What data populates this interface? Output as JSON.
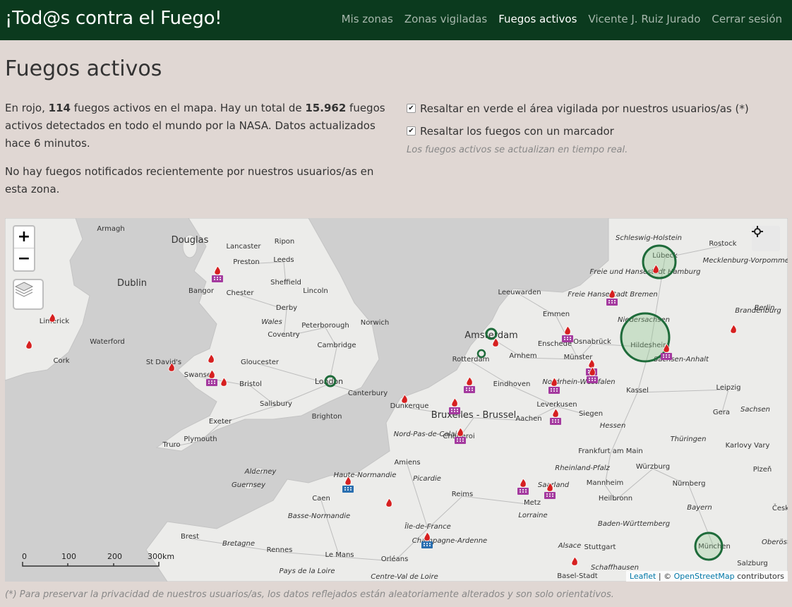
{
  "navbar": {
    "brand": "¡Tod@s contra el Fuego!",
    "links": [
      "Mis zonas",
      "Zonas vigiladas",
      "Fuegos activos",
      "Vicente J. Ruiz Jurado",
      "Cerrar sesión"
    ],
    "active_index": 2
  },
  "page": {
    "title": "Fuegos activos",
    "intro": {
      "p1": "En rojo, ",
      "count_visible": "114",
      "p2": " fuegos activos en el mapa. Hay un total de ",
      "count_total": "15.962",
      "p3": " fuegos activos detectados en todo el mundo por la NASA. Datos actualizados hace 6 minutos."
    },
    "notice": "No hay fuegos notificados recientemente por nuestros usuarios/as en esta zona.",
    "options": {
      "highlight_area": {
        "label": "Resaltar en verde el área vigilada por nuestros usuarios/as (*)",
        "checked": true
      },
      "highlight_markers": {
        "label": "Resaltar los fuegos con un marcador",
        "checked": true
      }
    },
    "realtime_note": "Los fuegos activos se actualizan en tiempo real.",
    "footer_note": "(*) Para preservar la privacidad de nuestros usuarios/as, los datos reflejados están aleatoriamente alterados y son solo orientativos."
  },
  "map": {
    "zoom_in": "+",
    "zoom_out": "−",
    "scale_labels": [
      "0",
      "100",
      "200",
      "300km"
    ],
    "attribution": {
      "leaflet": "Leaflet",
      "sep": " | © ",
      "osm": "OpenStreetMap",
      "suffix": " contributors"
    },
    "cities": [
      {
        "name": "Armagh"
      },
      {
        "name": "Douglas"
      },
      {
        "name": "Lancaster"
      },
      {
        "name": "Ripon"
      },
      {
        "name": "Preston"
      },
      {
        "name": "Leeds"
      },
      {
        "name": "Dublin"
      },
      {
        "name": "Bangor"
      },
      {
        "name": "Sheffield"
      },
      {
        "name": "Chester"
      },
      {
        "name": "Lincoln"
      },
      {
        "name": "Derby"
      },
      {
        "name": "Limerick"
      },
      {
        "name": "Wales"
      },
      {
        "name": "Norwich"
      },
      {
        "name": "Coventry"
      },
      {
        "name": "Peterborough"
      },
      {
        "name": "Waterford"
      },
      {
        "name": "Cambridge"
      },
      {
        "name": "Cork"
      },
      {
        "name": "St David's"
      },
      {
        "name": "Gloucester"
      },
      {
        "name": "Swansea"
      },
      {
        "name": "Bristol"
      },
      {
        "name": "London"
      },
      {
        "name": "Canterbury"
      },
      {
        "name": "Salisbury"
      },
      {
        "name": "Dunkerque"
      },
      {
        "name": "Exeter"
      },
      {
        "name": "Brighton"
      },
      {
        "name": "Truro"
      },
      {
        "name": "Plymouth"
      },
      {
        "name": "Leeuwarden"
      },
      {
        "name": "Emmen"
      },
      {
        "name": "Amsterdam"
      },
      {
        "name": "Enschede"
      },
      {
        "name": "Osnabrück"
      },
      {
        "name": "Rotterdam"
      },
      {
        "name": "Arnhem"
      },
      {
        "name": "Münster"
      },
      {
        "name": "Eindhoven"
      },
      {
        "name": "Bruxelles - Brussel"
      },
      {
        "name": "Leverkusen"
      },
      {
        "name": "Aachen"
      },
      {
        "name": "Siegen"
      },
      {
        "name": "Charleroi"
      },
      {
        "name": "Nord-Pas-de-Calais"
      },
      {
        "name": "Amiens"
      },
      {
        "name": "Picardie"
      },
      {
        "name": "Reims"
      },
      {
        "name": "Alderney"
      },
      {
        "name": "Guernsey"
      },
      {
        "name": "Caen"
      },
      {
        "name": "Haute-Normandie"
      },
      {
        "name": "Basse-Normandie"
      },
      {
        "name": "Île-de-France"
      },
      {
        "name": "Champagne-Ardenne"
      },
      {
        "name": "Metz"
      },
      {
        "name": "Lorraine"
      },
      {
        "name": "Alsace"
      },
      {
        "name": "Brest"
      },
      {
        "name": "Bretagne"
      },
      {
        "name": "Rennes"
      },
      {
        "name": "Le Mans"
      },
      {
        "name": "Orléans"
      },
      {
        "name": "Pays de la Loire"
      },
      {
        "name": "Centre-Val de Loire"
      },
      {
        "name": "Schleswig-Holstein"
      },
      {
        "name": "Rostock"
      },
      {
        "name": "Lübeck"
      },
      {
        "name": "Mecklenburg-Vorpommern"
      },
      {
        "name": "Freie und Hansestadt Hamburg"
      },
      {
        "name": "Freie Hansestadt Bremen"
      },
      {
        "name": "Brandenburg"
      },
      {
        "name": "Berlin"
      },
      {
        "name": "Niedersachsen"
      },
      {
        "name": "Hildesheim"
      },
      {
        "name": "Sachsen-Anhalt"
      },
      {
        "name": "Nordrhein-Westfalen"
      },
      {
        "name": "Kassel"
      },
      {
        "name": "Leipzig"
      },
      {
        "name": "Gera"
      },
      {
        "name": "Sachsen"
      },
      {
        "name": "Hessen"
      },
      {
        "name": "Thüringen"
      },
      {
        "name": "Frankfurt am Main"
      },
      {
        "name": "Karlovy Vary"
      },
      {
        "name": "Rheinland-Pfalz"
      },
      {
        "name": "Plzeň"
      },
      {
        "name": "Würzburg"
      },
      {
        "name": "Mannheim"
      },
      {
        "name": "Nürnberg"
      },
      {
        "name": "Saarland"
      },
      {
        "name": "Heilbronn"
      },
      {
        "name": "Bayern"
      },
      {
        "name": "Baden-Württemberg"
      },
      {
        "name": "Stuttgart"
      },
      {
        "name": "München"
      },
      {
        "name": "Schaffhausen"
      },
      {
        "name": "Basel-Stadt"
      },
      {
        "name": "Salzburg"
      },
      {
        "name": "Oberöste"
      },
      {
        "name": "Česk"
      }
    ]
  }
}
